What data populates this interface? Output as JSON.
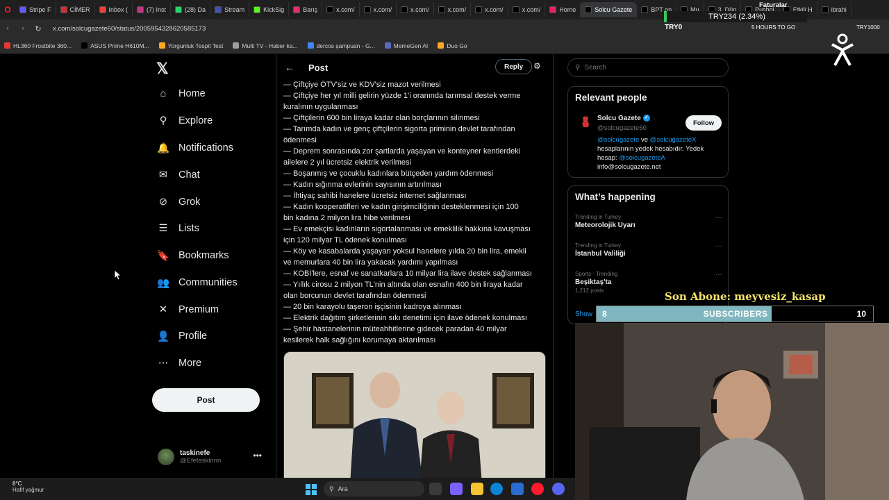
{
  "browser": {
    "tabs": [
      {
        "label": "Stripe F",
        "color": "#635bff"
      },
      {
        "label": "CİMER",
        "color": "#d32f2f"
      },
      {
        "label": "Inbox (",
        "color": "#ea4335"
      },
      {
        "label": "(7) Inst",
        "color": "#c13584"
      },
      {
        "label": "(28) Da",
        "color": "#25d366"
      },
      {
        "label": "Stream",
        "color": "#3f51b5"
      },
      {
        "label": "KickSig",
        "color": "#53fc18"
      },
      {
        "label": "Barış",
        "color": "#e1306c"
      },
      {
        "label": "x.com/",
        "color": "#000000"
      },
      {
        "label": "x.com/",
        "color": "#000000"
      },
      {
        "label": "x.com/",
        "color": "#000000"
      },
      {
        "label": "x.com/",
        "color": "#000000"
      },
      {
        "label": "x.com/",
        "color": "#000000"
      },
      {
        "label": "x.com/",
        "color": "#000000"
      },
      {
        "label": "Home",
        "color": "#e91e63"
      },
      {
        "label": "Solcu Gazete",
        "color": "#000000",
        "active": true
      },
      {
        "label": "BPT on",
        "color": "#000000"
      },
      {
        "label": "Mu",
        "color": "#000000"
      },
      {
        "label": "3. Dün",
        "color": "#000000"
      },
      {
        "label": "Pushol",
        "color": "#000000"
      },
      {
        "label": "Etkili H",
        "color": "#000000"
      },
      {
        "label": "ibrahi",
        "color": "#000000"
      }
    ],
    "url": "x.com/solcugazete60/status/2005954328620585173",
    "bookmarks": [
      {
        "label": "HL360 Frostbite 360...",
        "color": "#e53935"
      },
      {
        "label": "ASUS Prime H610M...",
        "color": "#000000"
      },
      {
        "label": "Yorgunluk Tespit Test",
        "color": "#f9a825"
      },
      {
        "label": "Multi TV - Haber ka...",
        "color": "#9e9e9e"
      },
      {
        "label": "dercos şampuan - G...",
        "color": "#4285f4"
      },
      {
        "label": "MemeGen AI",
        "color": "#5c6bc0"
      },
      {
        "label": "Duo Go",
        "color": "#f9a825"
      }
    ]
  },
  "nav": {
    "items": [
      {
        "label": "Home",
        "icon": "home-icon",
        "glyph": "⌂"
      },
      {
        "label": "Explore",
        "icon": "search-icon",
        "glyph": "⚲"
      },
      {
        "label": "Notifications",
        "icon": "bell-icon",
        "glyph": "🔔"
      },
      {
        "label": "Chat",
        "icon": "mail-icon",
        "glyph": "✉"
      },
      {
        "label": "Grok",
        "icon": "grok-icon",
        "glyph": "⊘"
      },
      {
        "label": "Lists",
        "icon": "list-icon",
        "glyph": "☰"
      },
      {
        "label": "Bookmarks",
        "icon": "bookmark-icon",
        "glyph": "🔖"
      },
      {
        "label": "Communities",
        "icon": "communities-icon",
        "glyph": "👥"
      },
      {
        "label": "Premium",
        "icon": "x-icon",
        "glyph": "✕"
      },
      {
        "label": "Profile",
        "icon": "profile-icon",
        "glyph": "👤"
      },
      {
        "label": "More",
        "icon": "more-circle-icon",
        "glyph": "⋯"
      }
    ],
    "post_label": "Post",
    "account": {
      "name": "taskinefe",
      "handle": "@Efetaskinnn"
    }
  },
  "post": {
    "header_title": "Post",
    "reply_label": "Reply",
    "lines": [
      "— Çiftçiye ÖTV'siz ve KDV'siz mazot verilmesi",
      "— Çiftçiye her yıl milli gelirin yüzde 1'i oranında tarımsal destek verme",
      "kuralının uygulanması",
      "— Çiftçilerin 600 bin liraya kadar olan borçlarının silinmesi",
      "— Tarımda kadın ve genç çiftçilerin sigorta priminin devlet tarafından",
      "ödenmesi",
      "— Deprem sonrasında zor şartlarda yaşayan ve konteyner kentlerdeki",
      "ailelere 2 yıl ücretsiz elektrik verilmesi",
      "— Boşanmış ve çocuklu kadınlara bütçeden yardım ödenmesi",
      "— Kadın sığınma evlerinin sayısının artırılması",
      "— İhtiyaç sahibi hanelere ücretsiz internet sağlanması",
      "— Kadın kooperatifleri ve kadın girişimciliğinin desteklenmesi için 100",
      "bin kadına 2 milyon lira hibe verilmesi",
      "— Ev emekçisi kadınların sigortalanması ve emeklilik hakkına kavuşması",
      "için 120 milyar TL ödenek konulması",
      "— Köy ve kasabalarda yaşayan yoksul hanelere yılda 20 bin lira, emekli",
      "ve memurlara 40 bin lira yakacak yardımı yapılması",
      "— KOBİ'lere, esnaf ve sanatkarlara 10 milyar lira ilave destek sağlanması",
      "— Yıllık cirosu 2 milyon TL'nin altında olan esnafın 400 bin liraya kadar",
      "olan borcunun devlet tarafından ödenmesi",
      "— 20 bin karayolu taşeron işçisinin kadroya alınması",
      "— Elektrik dağıtım şirketlerinin sıkı denetimi için ilave ödenek konulması",
      "— Şehir hastanelerinin müteahhitlerine gidecek paradan 40 milyar",
      "kesilerek halk sağlığını korumaya aktarılması"
    ]
  },
  "sidebar": {
    "search_placeholder": "Search",
    "relevant_title": "Relevant people",
    "person": {
      "name": "Solcu Gazete",
      "handle": "@solcugazete60",
      "follow_label": "Follow",
      "bio_mention1": "@solcugazete",
      "bio_and": " ve ",
      "bio_mention2": "@solcugazeteX",
      "bio_text": " hesaplarının yedek hesabıdır. Yedek hesap: ",
      "bio_mention3": "@solcugazeteA",
      "bio_email": "info@solcugazete.net"
    },
    "happening_title": "What’s happening",
    "trends": [
      {
        "meta": "Trending in Turkey",
        "name": "Meteorolojik Uyarı",
        "count": ""
      },
      {
        "meta": "Trending in Turkey",
        "name": "İstanbul Valiliği",
        "count": ""
      },
      {
        "meta": "Sports · Trending",
        "name": "Beşiktaş'ta",
        "count": "1,212 posts"
      }
    ],
    "show_more": "Show"
  },
  "overlay": {
    "ticker": "TRY234 (2.34%)",
    "ticker_symbol": "TRY0",
    "faturalar": "Faturalar",
    "hours": "5 HOURS TO GO",
    "ticker_right": "TRY1000",
    "son_abone": "Son Abone: meyvesiz_kasap",
    "subs_current": "8",
    "subs_label": "SUBSCRIBERS",
    "subs_goal": "10",
    "subs_progress": 0.8
  },
  "taskbar": {
    "temp": "8°C",
    "weather": "Hafif yağmur",
    "search_placeholder": "Ara"
  }
}
